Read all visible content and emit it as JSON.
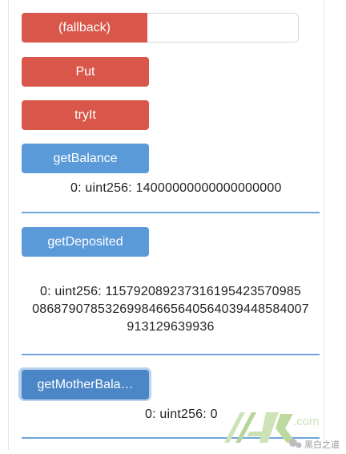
{
  "fallback": {
    "label": "(fallback)",
    "value": ""
  },
  "put": {
    "label": "Put"
  },
  "tryit": {
    "label": "tryIt"
  },
  "getBalance": {
    "label": "getBalance",
    "result": "0: uint256: 14000000000000000000"
  },
  "getDeposited": {
    "label": "getDeposited",
    "result_lines": [
      "0: uint256: 115792089237316195423570985",
      "08687907853269984665640564039448584007",
      "913129639936"
    ]
  },
  "getMotherBalance": {
    "label": "getMotherBala…",
    "result": "0: uint256: 0"
  },
  "watermark": {
    "text": ".com",
    "brand": "黑白之道"
  },
  "colors": {
    "red": "#d9564a",
    "blue": "#5b9ad8",
    "divider": "#6ea6db"
  }
}
